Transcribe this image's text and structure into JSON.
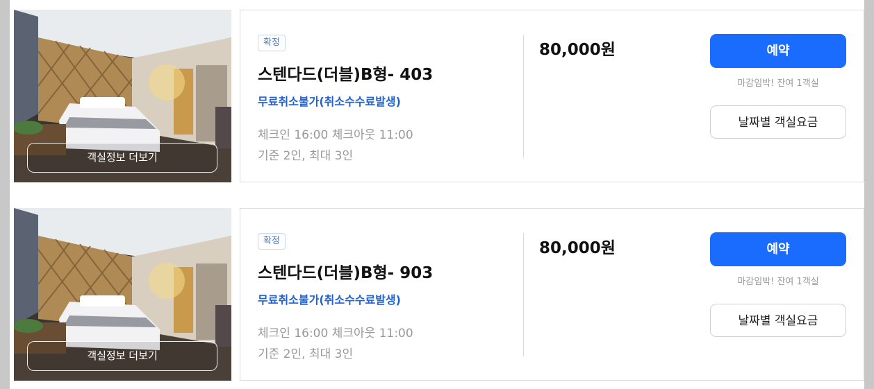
{
  "rooms": [
    {
      "badge": "확정",
      "name": "스텐다드(더블)B형- 403",
      "cancel_note": "무료취소불가(취소수수료발생)",
      "checkin": "체크인 16:00 체크아웃 11:00",
      "capacity": "기준 2인, 최대 3인",
      "price": "80,000원",
      "reserve_label": "예약",
      "remaining": "마감임박! 잔여 1객실",
      "daily_rate_label": "날짜별 객실요금",
      "more_info_label": "객실정보 더보기"
    },
    {
      "badge": "확정",
      "name": "스텐다드(더블)B형- 903",
      "cancel_note": "무료취소불가(취소수수료발생)",
      "checkin": "체크인 16:00 체크아웃 11:00",
      "capacity": "기준 2인, 최대 3인",
      "price": "80,000원",
      "reserve_label": "예약",
      "remaining": "마감임박! 잔여 1객실",
      "daily_rate_label": "날짜별 객실요금",
      "more_info_label": "객실정보 더보기"
    }
  ],
  "colors": {
    "accent": "#1a6cff",
    "cancel_text": "#1e62d6",
    "badge_text": "#4a78c8"
  }
}
